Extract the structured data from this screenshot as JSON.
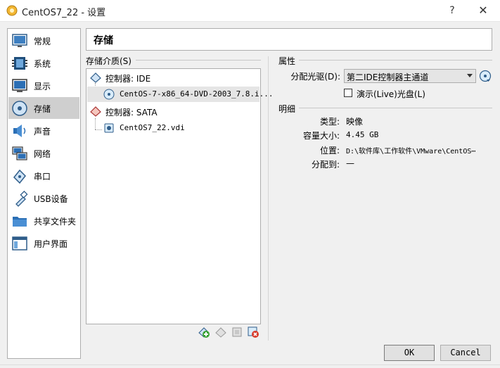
{
  "window": {
    "title": "CentOS7_22 - 设置",
    "help": "?",
    "close": "✕"
  },
  "sidebar": {
    "items": [
      {
        "label": "常规",
        "icon": "general-icon"
      },
      {
        "label": "系统",
        "icon": "system-chip-icon"
      },
      {
        "label": "显示",
        "icon": "display-monitor-icon"
      },
      {
        "label": "存储",
        "icon": "storage-disk-icon",
        "active": true
      },
      {
        "label": "声音",
        "icon": "speaker-icon"
      },
      {
        "label": "网络",
        "icon": "network-icon"
      },
      {
        "label": "串口",
        "icon": "serial-port-icon"
      },
      {
        "label": "USB设备",
        "icon": "usb-icon"
      },
      {
        "label": "共享文件夹",
        "icon": "shared-folder-icon"
      },
      {
        "label": "用户界面",
        "icon": "user-interface-icon"
      }
    ]
  },
  "page": {
    "title": "存储"
  },
  "storage": {
    "section_label": "存储介质(S)",
    "tree": [
      {
        "label": "控制器: IDE",
        "icon": "controller-ide-icon"
      },
      {
        "label": "CentOS-7-x86_64-DVD-2003_7.8.i...",
        "icon": "optical-disc-icon",
        "selected": true
      },
      {
        "label": "控制器: SATA",
        "icon": "controller-sata-icon"
      },
      {
        "label": "CentOS7_22.vdi",
        "icon": "hard-disk-icon"
      }
    ]
  },
  "attributes": {
    "section_label": "属性",
    "optical_drive_label": "分配光驱(D):",
    "optical_drive_value": "第二IDE控制器主通道",
    "live_cd_label": "演示(Live)光盘(L)",
    "live_cd_checked": false
  },
  "details": {
    "section_label": "明细",
    "rows": [
      {
        "label": "类型:",
        "value": "映像"
      },
      {
        "label": "容量大小:",
        "value": "4.45  GB"
      },
      {
        "label": "位置:",
        "value": "D:\\软件库\\工作软件\\VMware\\CentOS⋯"
      },
      {
        "label": "分配到:",
        "value": "—"
      }
    ]
  },
  "footer": {
    "ok": "OK",
    "cancel": "Cancel"
  },
  "colors": {
    "accent": "#0078d7",
    "selected_nav": "#cfcfcf"
  }
}
